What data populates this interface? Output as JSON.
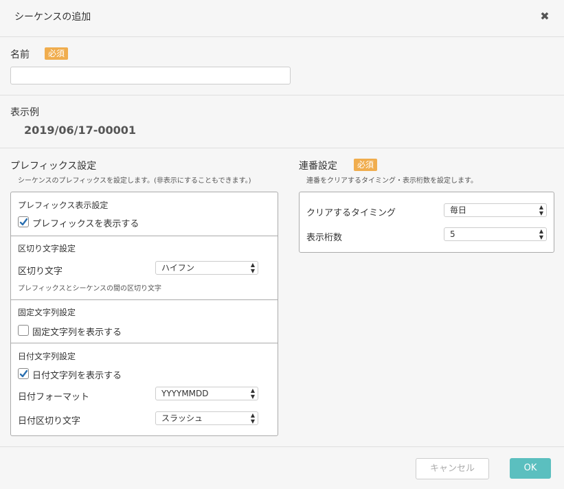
{
  "dialog": {
    "title": "シーケンスの追加",
    "close_icon": "close-icon"
  },
  "name_section": {
    "label": "名前",
    "required_badge": "必須",
    "value": "",
    "placeholder": ""
  },
  "example_section": {
    "label": "表示例",
    "value": "2019/06/17-00001"
  },
  "prefix_settings": {
    "heading": "プレフィックス設定",
    "description": "シーケンスのプレフィックスを設定します。(非表示にすることもできます。)",
    "display_group": {
      "title": "プレフィックス表示設定",
      "checkbox_label": "プレフィックスを表示する",
      "checked": true
    },
    "separator_group": {
      "title": "区切り文字設定",
      "row_label": "区切り文字",
      "selected": "ハイフン",
      "hint": "プレフィックスとシーケンスの間の区切り文字"
    },
    "fixed_string_group": {
      "title": "固定文字列設定",
      "checkbox_label": "固定文字列を表示する",
      "checked": false
    },
    "date_string_group": {
      "title": "日付文字列設定",
      "checkbox_label": "日付文字列を表示する",
      "checked": true,
      "format_label": "日付フォーマット",
      "format_selected": "YYYYMMDD",
      "separator_label": "日付区切り文字",
      "separator_selected": "スラッシュ"
    }
  },
  "serial_settings": {
    "heading": "連番設定",
    "required_badge": "必須",
    "description": "連番をクリアするタイミング・表示桁数を設定します。",
    "clear_timing_label": "クリアするタイミング",
    "clear_timing_selected": "毎日",
    "digits_label": "表示桁数",
    "digits_selected": "5"
  },
  "footer": {
    "cancel_label": "キャンセル",
    "ok_label": "OK"
  },
  "colors": {
    "accent": "#5bbfbf",
    "badge": "#f0ad4e",
    "check": "#2a6fb0"
  }
}
